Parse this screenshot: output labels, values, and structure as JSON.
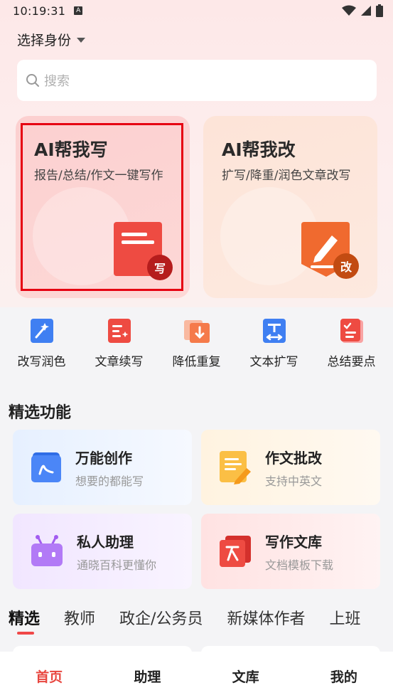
{
  "status_bar": {
    "time": "10:19:31",
    "badge": "A"
  },
  "identity": {
    "label": "选择身份"
  },
  "search": {
    "placeholder": "搜索"
  },
  "hero_cards": [
    {
      "title": "AI帮我写",
      "desc": "报告/总结/作文一键写作",
      "badge": "写",
      "color": "#e8413a"
    },
    {
      "title": "AI帮我改",
      "desc": "扩写/降重/润色文章改写",
      "badge": "改",
      "color": "#f06a2f"
    }
  ],
  "quick_tools": [
    {
      "label": "改写润色",
      "icon": "magic-wand-icon"
    },
    {
      "label": "文章续写",
      "icon": "document-sparkle-icon"
    },
    {
      "label": "降低重复",
      "icon": "document-down-icon"
    },
    {
      "label": "文本扩写",
      "icon": "text-expand-icon"
    },
    {
      "label": "总结要点",
      "icon": "checklist-icon"
    }
  ],
  "featured": {
    "title": "精选功能",
    "items": [
      {
        "title": "万能创作",
        "subtitle": "想要的都能写",
        "icon": "pen-book-icon"
      },
      {
        "title": "作文批改",
        "subtitle": "支持中英文",
        "icon": "paper-pencil-icon"
      },
      {
        "title": "私人助理",
        "subtitle": "通晓百科更懂你",
        "icon": "robot-icon"
      },
      {
        "title": "写作文库",
        "subtitle": "文档模板下载",
        "icon": "library-icon"
      }
    ]
  },
  "category_tabs": [
    "精选",
    "教师",
    "政企/公务员",
    "新媒体作者",
    "上班"
  ],
  "bottom_nav": [
    "首页",
    "助理",
    "文库",
    "我的"
  ],
  "colors": {
    "accent": "#e8463f",
    "highlight": "#e60012"
  }
}
